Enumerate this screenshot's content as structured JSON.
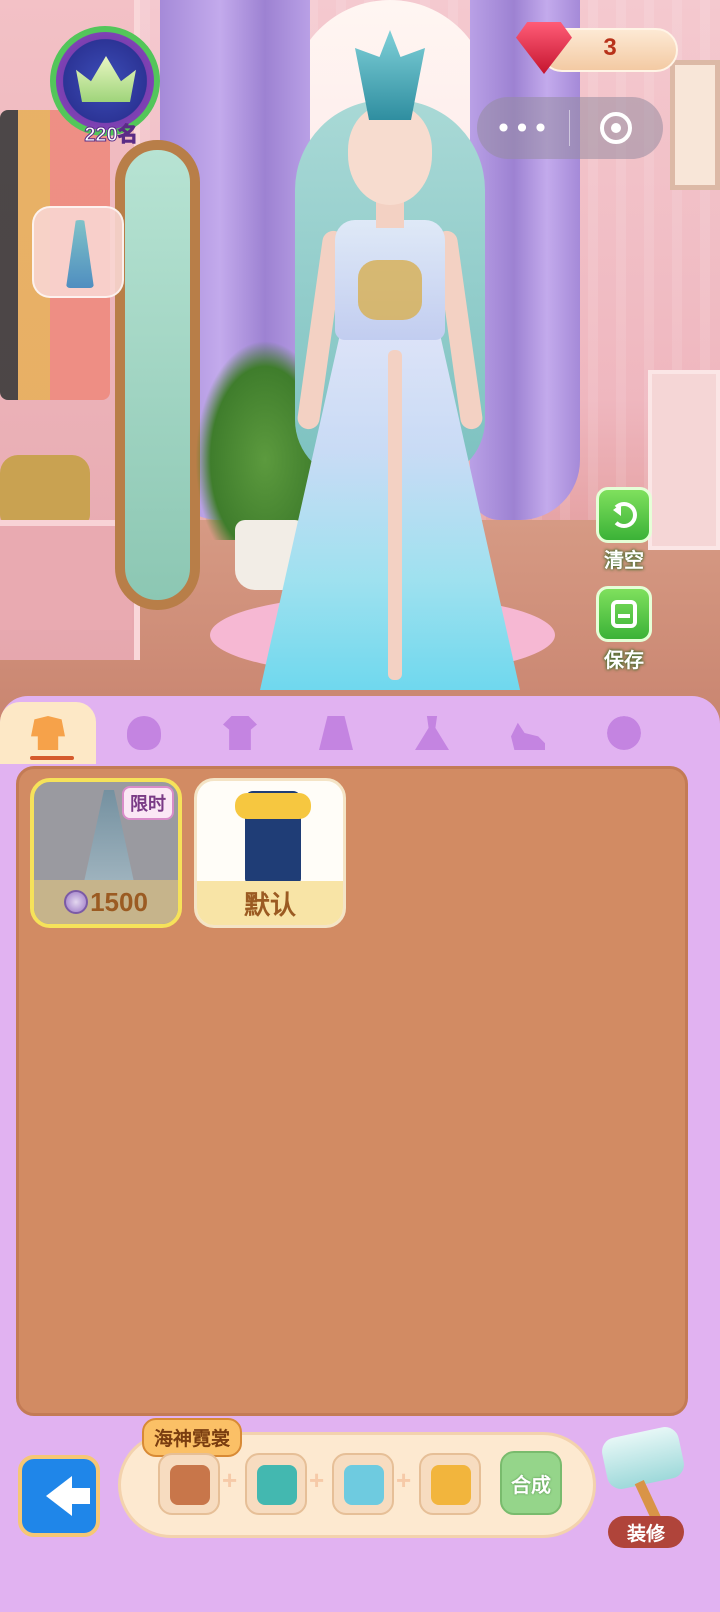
{
  "hud": {
    "rank_label": "220名",
    "gems": "3"
  },
  "side_buttons": {
    "clear_label": "清空",
    "save_label": "保存"
  },
  "tabs": [
    {
      "name": "suit",
      "icon": "outfit-icon"
    },
    {
      "name": "hair",
      "icon": "hair-icon"
    },
    {
      "name": "top",
      "icon": "shirt-icon"
    },
    {
      "name": "bottom",
      "icon": "skirt-icon"
    },
    {
      "name": "dress",
      "icon": "dress-icon"
    },
    {
      "name": "shoes",
      "icon": "high-heel-icon"
    },
    {
      "name": "accessory",
      "icon": "accessory-icon"
    }
  ],
  "items": [
    {
      "tag": "限时",
      "price": "1500",
      "currency_icon": "coin-icon",
      "selected": true
    },
    {
      "label": "默认"
    }
  ],
  "recipe": {
    "title": "海神霓裳",
    "plus": "+",
    "synth_label": "合成"
  },
  "decorate_label": "装修",
  "colors": {
    "panel": "#e1b2f1",
    "content": "#d28b63",
    "accent_green": "#3bb237",
    "back_button": "#1f86e9"
  }
}
